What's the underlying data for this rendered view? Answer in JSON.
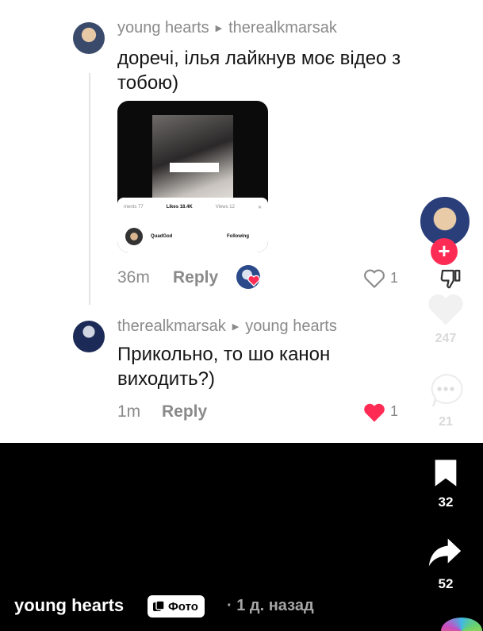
{
  "comments": [
    {
      "author": "young hearts",
      "reply_to": "therealkmarsak",
      "text": "доречі, ілья лайкнув моє відео з тобою)",
      "time": "36m",
      "reply_label": "Reply",
      "likes": "1",
      "attachment": {
        "tab_comments": "ments 77",
        "tab_likes": "Likes 18.4K",
        "tab_views": "Views 12",
        "user": "QuadGod",
        "follow": "Following"
      }
    },
    {
      "author": "therealkmarsak",
      "reply_to": "young hearts",
      "text": "Прикольно, то шо канон виходить?)",
      "time": "1m",
      "reply_label": "Reply",
      "likes": "1"
    }
  ],
  "rail": {
    "like_count": "247",
    "comment_count": "21",
    "save_count": "32",
    "share_count": "52"
  },
  "post": {
    "username": "young hearts",
    "badge": "Фото",
    "time": "· 1 д. назад"
  },
  "colors": {
    "accent": "#fe2c55",
    "meta_gray": "#8a8a8a",
    "bottom_bg": "#000000"
  }
}
